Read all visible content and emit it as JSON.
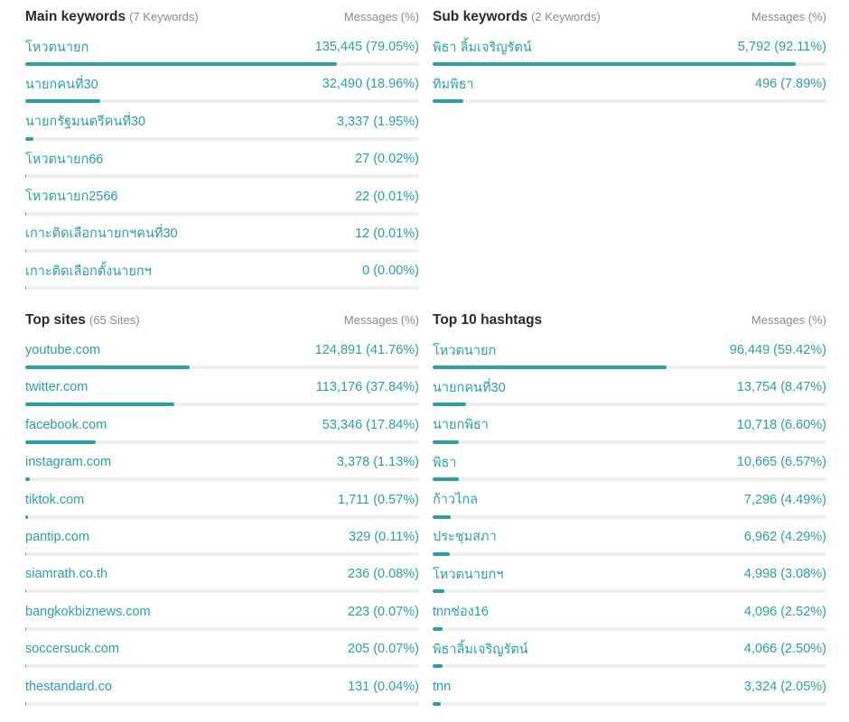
{
  "colors": {
    "accent": "#2aa0a6",
    "bar_fill": "#2a9fa4",
    "bar_track": "#efefef",
    "title": "#2b2b2b",
    "muted": "#8a8a8a"
  },
  "panels": {
    "main_keywords": {
      "title": "Main keywords",
      "count": "(7 Keywords)",
      "column_label": "Messages (%)",
      "rows": [
        {
          "label": "โหวตนายก",
          "value": "135,445 (79.05%)",
          "percent": 79.05
        },
        {
          "label": "นายกคนที่30",
          "value": "32,490 (18.96%)",
          "percent": 18.96
        },
        {
          "label": "นายกรัฐมนตรีคนที่30",
          "value": "3,337 (1.95%)",
          "percent": 1.95
        },
        {
          "label": "โหวตนายก66",
          "value": "27 (0.02%)",
          "percent": 0.02
        },
        {
          "label": "โหวตนายก2566",
          "value": "22 (0.01%)",
          "percent": 0.01
        },
        {
          "label": "เกาะติดเลือกนายกฯคนที่30",
          "value": "12 (0.01%)",
          "percent": 0.01
        },
        {
          "label": "เกาะติดเลือกตั้งนายกฯ",
          "value": "0 (0.00%)",
          "percent": 0.0
        }
      ]
    },
    "sub_keywords": {
      "title": "Sub keywords",
      "count": "(2 Keywords)",
      "column_label": "Messages (%)",
      "rows": [
        {
          "label": "พิธา ลิ้มเจริญรัตน์",
          "value": "5,792 (92.11%)",
          "percent": 92.11
        },
        {
          "label": "ทิมพิธา",
          "value": "496 (7.89%)",
          "percent": 7.89
        }
      ]
    },
    "top_sites": {
      "title": "Top sites",
      "count": "(65 Sites)",
      "column_label": "Messages (%)",
      "rows": [
        {
          "label": "youtube.com",
          "value": "124,891 (41.76%)",
          "percent": 41.76
        },
        {
          "label": "twitter.com",
          "value": "113,176 (37.84%)",
          "percent": 37.84
        },
        {
          "label": "facebook.com",
          "value": "53,346 (17.84%)",
          "percent": 17.84
        },
        {
          "label": "instagram.com",
          "value": "3,378 (1.13%)",
          "percent": 1.13
        },
        {
          "label": "tiktok.com",
          "value": "1,711 (0.57%)",
          "percent": 0.57
        },
        {
          "label": "pantip.com",
          "value": "329 (0.11%)",
          "percent": 0.11
        },
        {
          "label": "siamrath.co.th",
          "value": "236 (0.08%)",
          "percent": 0.08
        },
        {
          "label": "bangkokbiznews.com",
          "value": "223 (0.07%)",
          "percent": 0.07
        },
        {
          "label": "soccersuck.com",
          "value": "205 (0.07%)",
          "percent": 0.07
        },
        {
          "label": "thestandard.co",
          "value": "131 (0.04%)",
          "percent": 0.04
        }
      ]
    },
    "top_hashtags": {
      "title": "Top 10 hashtags",
      "count": "",
      "column_label": "Messages (%)",
      "rows": [
        {
          "label": "โหวตนายก",
          "value": "96,449 (59.42%)",
          "percent": 59.42
        },
        {
          "label": "นายกคนที่30",
          "value": "13,754 (8.47%)",
          "percent": 8.47
        },
        {
          "label": "นายกพิธา",
          "value": "10,718 (6.60%)",
          "percent": 6.6
        },
        {
          "label": "พิธา",
          "value": "10,665 (6.57%)",
          "percent": 6.57
        },
        {
          "label": "ก้าวไกล",
          "value": "7,296 (4.49%)",
          "percent": 4.49
        },
        {
          "label": "ประชุมสภา",
          "value": "6,962 (4.29%)",
          "percent": 4.29
        },
        {
          "label": "โหวตนายกฯ",
          "value": "4,998 (3.08%)",
          "percent": 3.08
        },
        {
          "label": "tnnช่อง16",
          "value": "4,096 (2.52%)",
          "percent": 2.52
        },
        {
          "label": "พิธาลิ้มเจริญรัตน์",
          "value": "4,066 (2.50%)",
          "percent": 2.5
        },
        {
          "label": "tnn",
          "value": "3,324 (2.05%)",
          "percent": 2.05
        }
      ]
    }
  }
}
